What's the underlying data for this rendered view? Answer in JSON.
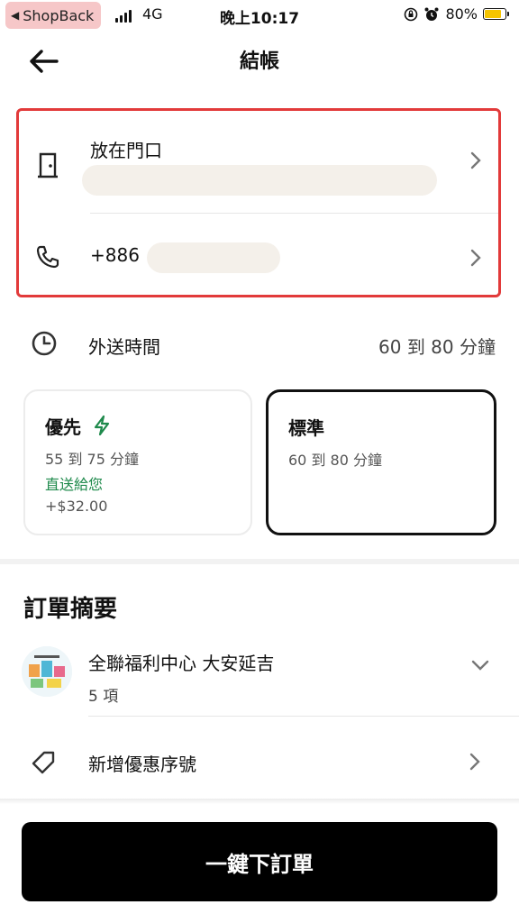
{
  "status_bar": {
    "back_app": "ShopBack",
    "network": "4G",
    "time": "晚上10:17",
    "battery": "80%",
    "battery_level": 0.8
  },
  "header": {
    "title": "結帳"
  },
  "address": {
    "dropoff_label": "放在門口",
    "phone_prefix": "+886"
  },
  "delivery": {
    "label": "外送時間",
    "time_range": "60 到 80 分鐘",
    "options": [
      {
        "name": "優先",
        "eta": "55 到 75 分鐘",
        "note": "直送給您",
        "price": "+$32.00"
      },
      {
        "name": "標準",
        "eta": "60 到 80 分鐘"
      }
    ]
  },
  "summary": {
    "title": "訂單摘要",
    "store_name": "全聯福利中心 大安延吉",
    "item_count": "5 項"
  },
  "promo": {
    "label": "新增優惠序號"
  },
  "footer": {
    "place_order": "一鍵下訂單"
  },
  "colors": {
    "highlight": "#e23a3a",
    "priority_green": "#1f8a4c",
    "button": "#000000"
  }
}
